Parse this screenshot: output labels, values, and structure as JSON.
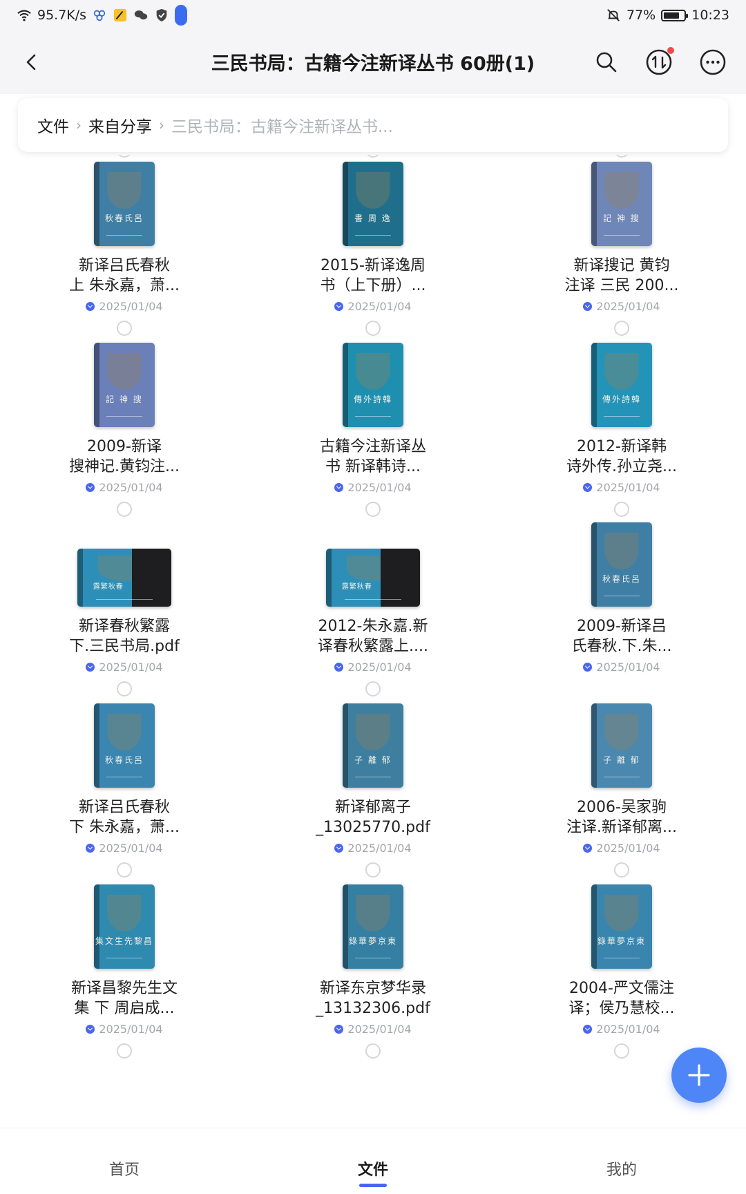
{
  "status": {
    "net_speed": "95.7K/s",
    "battery": "77%",
    "battery_level": 0.77,
    "time": "10:23"
  },
  "header": {
    "title": "三民书局：古籍今注新译丛书 60册(1)",
    "back_icon": "back-arrow-icon",
    "search_icon": "search-icon",
    "transfer_icon": "transfer-icon",
    "more_icon": "more-icon"
  },
  "breadcrumb": {
    "root": "文件",
    "shared": "来自分享",
    "current": "三民书局：古籍今注新译丛书..."
  },
  "files": [
    {
      "line1": "新译吕氏春秋",
      "line2": "上 朱永嘉，萧...",
      "date": "2025/01/04",
      "cover_title": "秋春氏呂",
      "cover_color": "#3f7fa6",
      "wide": false
    },
    {
      "line1": "2015-新译逸周",
      "line2": "书（上下册）...",
      "date": "2025/01/04",
      "cover_title": "書 周 逸",
      "cover_color": "#1f6f8c",
      "wide": false
    },
    {
      "line1": "新译搜记 黄钧",
      "line2": "注译 三民 200...",
      "date": "2025/01/04",
      "cover_title": "記 神 搜",
      "cover_color": "#6f86b8",
      "wide": false
    },
    {
      "line1": "2009-新译",
      "line2": "搜神记.黄钧注...",
      "date": "2025/01/04",
      "cover_title": "記 神 搜",
      "cover_color": "#6b7fb8",
      "wide": false
    },
    {
      "line1": "古籍今注新译丛",
      "line2": "书 新译韩诗...",
      "date": "2025/01/04",
      "cover_title": "傳外詩韓",
      "cover_color": "#1f8fb0",
      "wide": false
    },
    {
      "line1": "2012-新译韩",
      "line2": "诗外传.孙立尧...",
      "date": "2025/01/04",
      "cover_title": "傳外詩韓",
      "cover_color": "#2393b8",
      "wide": false
    },
    {
      "line1": "新译春秋繁露",
      "line2": "下.三民书局.pdf",
      "date": "2025/01/04",
      "cover_title": "露繁秋春",
      "cover_color": "#2d8fb8",
      "wide": true
    },
    {
      "line1": "2012-朱永嘉.新",
      "line2": "译春秋繁露上....",
      "date": "2025/01/04",
      "cover_title": "露繁秋春",
      "cover_color": "#2d8fb8",
      "wide": true
    },
    {
      "line1": "2009-新译吕",
      "line2": "氏春秋.下.朱...",
      "date": "2025/01/04",
      "cover_title": "秋春氏呂",
      "cover_color": "#3f7fa6",
      "wide": false
    },
    {
      "line1": "新译吕氏春秋",
      "line2": "下 朱永嘉，萧...",
      "date": "2025/01/04",
      "cover_title": "秋春氏呂",
      "cover_color": "#3a86b0",
      "wide": false
    },
    {
      "line1": "新译郁离子",
      "line2": "_13025770.pdf",
      "date": "2025/01/04",
      "cover_title": "子 離 郁",
      "cover_color": "#3e7fa0",
      "wide": false
    },
    {
      "line1": "2006-吴家驹",
      "line2": "注译.新译郁离...",
      "date": "2025/01/04",
      "cover_title": "子 離 郁",
      "cover_color": "#4a88b0",
      "wide": false
    },
    {
      "line1": "新译昌黎先生文",
      "line2": "集 下 周启成...",
      "date": "2025/01/04",
      "cover_title": "集文生先黎昌",
      "cover_color": "#2f8ab0",
      "wide": false
    },
    {
      "line1": "新译东京梦华录",
      "line2": "_13132306.pdf",
      "date": "2025/01/04",
      "cover_title": "錄華夢京東",
      "cover_color": "#357fa3",
      "wide": false
    },
    {
      "line1": "2004-严文儒注",
      "line2": "译；侯乃慧校...",
      "date": "2025/01/04",
      "cover_title": "錄華夢京東",
      "cover_color": "#3a85ad",
      "wide": false
    }
  ],
  "fab": {
    "icon": "plus-icon"
  },
  "bottom_nav": [
    {
      "label": "首页",
      "active": false
    },
    {
      "label": "文件",
      "active": true
    },
    {
      "label": "我的",
      "active": false
    }
  ]
}
